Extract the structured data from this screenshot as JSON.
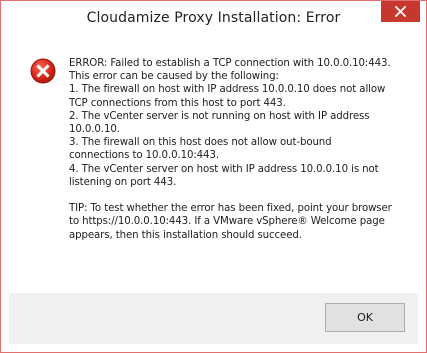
{
  "window": {
    "title": "Cloudamize Proxy Installation: Error",
    "close_icon": "close-icon",
    "accent_color": "#c7372d"
  },
  "dialog": {
    "icon": "error-icon",
    "message_lines": [
      "ERROR: Failed to establish a TCP connection with 10.0.0.10:443.",
      "This error can be caused by the following:",
      "1. The firewall on host with IP address 10.0.0.10 does not allow",
      "TCP connections from this host to port 443.",
      "2. The vCenter server is not running on host with IP address",
      "10.0.0.10.",
      "3. The firewall on this host does not allow out-bound",
      "connections to 10.0.0.10:443.",
      "4. The vCenter server on host with IP address 10.0.0.10 is not",
      "listening on port 443.",
      "",
      "TIP: To test whether the error has been fixed, point your browser",
      "to https://10.0.0.10:443. If a VMware vSphere® Welcome page",
      "appears, then this installation should succeed."
    ]
  },
  "footer": {
    "ok_label": "OK"
  }
}
